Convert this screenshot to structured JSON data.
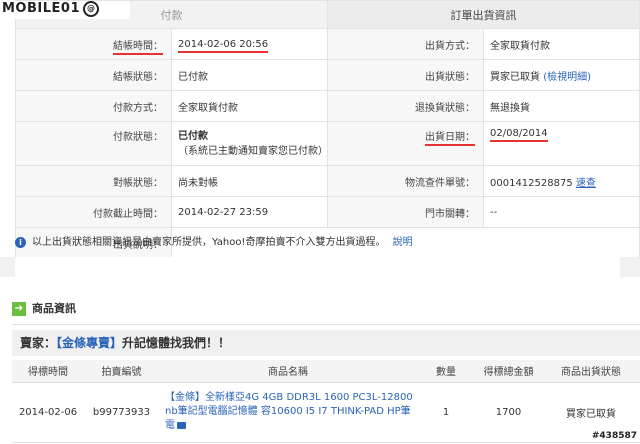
{
  "logo": {
    "text": "MOBILE01",
    "symbol": "@"
  },
  "order": {
    "header_left": "付款",
    "header_right": "訂單出貨資訊",
    "rows": [
      {
        "left_label": "結帳時間：",
        "left_value": "2014-02-06 20:56",
        "right_label": "出貨方式：",
        "right_value": "全家取貨付款"
      },
      {
        "left_label": "結帳狀態：",
        "left_value": "已付款",
        "right_label": "出貨狀態：",
        "right_value": "買家已取貨",
        "right_link": "(檢視明細)"
      },
      {
        "left_label": "付款方式：",
        "left_value": "全家取貨付款",
        "right_label": "退換貨狀態：",
        "right_value": "無退換貨"
      },
      {
        "left_label": "付款狀態：",
        "left_value": "已付款",
        "left_note": "（系統已主動通知賣家您已付款）",
        "right_label": "出貨日期：",
        "right_value": "02/08/2014"
      },
      {
        "left_label": "對帳狀態：",
        "left_value": "尚未對帳",
        "right_label": "物流查件單號：",
        "right_value": "0001412528875",
        "right_link": "速查"
      },
      {
        "left_label": "付款截止時間：",
        "left_value": "2014-02-27 23:59",
        "right_label": "門市關轉：",
        "right_value": "--"
      }
    ],
    "ship_note_label": "出貨說明："
  },
  "notice": {
    "icon": "info-icon",
    "text": "以上出貨狀態相關資訊是由賣家所提供，Yahoo!奇摩拍賣不介入雙方出貨過程。",
    "link": "說明"
  },
  "products": {
    "section_title": "商品資訊",
    "seller_prefix": "賣家：",
    "seller_name": "【金條專賣】",
    "seller_slogan": "升記憶體找我們！！",
    "columns": [
      "得標時間",
      "拍賣編號",
      "商品名稱",
      "數量",
      "得標總金額",
      "商品出貨狀態"
    ],
    "rows": [
      {
        "time": "2014-02-06",
        "id": "b99773933",
        "name": "【金條】全新樣亞4G 4GB DDR3L 1600 PC3L-12800 nb筆記型電腦記憶體 容10600 I5 I7 THINK-PAD HP筆電",
        "qty": "1",
        "amount": "1700",
        "status": "買家已取貨"
      }
    ]
  },
  "watermark": "#438587",
  "colors": {
    "accent_red": "#e53333",
    "link_blue": "#2a63b8",
    "arrow_green": "#6bbf3e"
  }
}
